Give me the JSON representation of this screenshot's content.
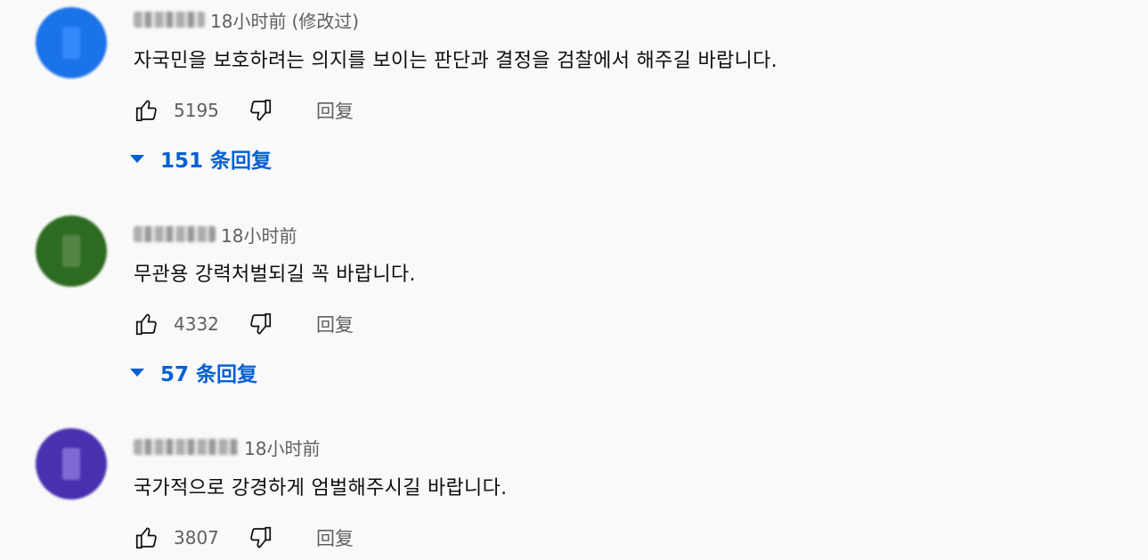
{
  "comments": [
    {
      "time": "18小时前",
      "edited": "(修改过)",
      "text": "자국민을 보호하려는 의지를 보이는 판단과 결정을 검찰에서 해주길 바랍니다.",
      "likes": "5195",
      "reply_label": "回复",
      "replies_label": "151 条回复",
      "avatar_color": "#1a73e8",
      "avatar_inner": "#3b8cff"
    },
    {
      "time": "18小时前",
      "edited": "",
      "text": "무관용 강력처벌되길 꼭 바랍니다.",
      "likes": "4332",
      "reply_label": "回复",
      "replies_label": "57 条回复",
      "avatar_color": "#2e6b22",
      "avatar_inner": "#5a8a4e"
    },
    {
      "time": "18小时前",
      "edited": "",
      "text": "국가적으로 강경하게 엄벌해주시길 바랍니다.",
      "likes": "3807",
      "reply_label": "回复",
      "avatar_color": "#4a2fb0",
      "avatar_inner": "#8a74d8"
    }
  ],
  "icons": {
    "like": "thumb-up-icon",
    "dislike": "thumb-down-icon",
    "expand": "caret-down-icon"
  },
  "colors": {
    "link_blue": "#065fd4",
    "secondary_text": "#606060",
    "background": "#f9f9f9"
  }
}
